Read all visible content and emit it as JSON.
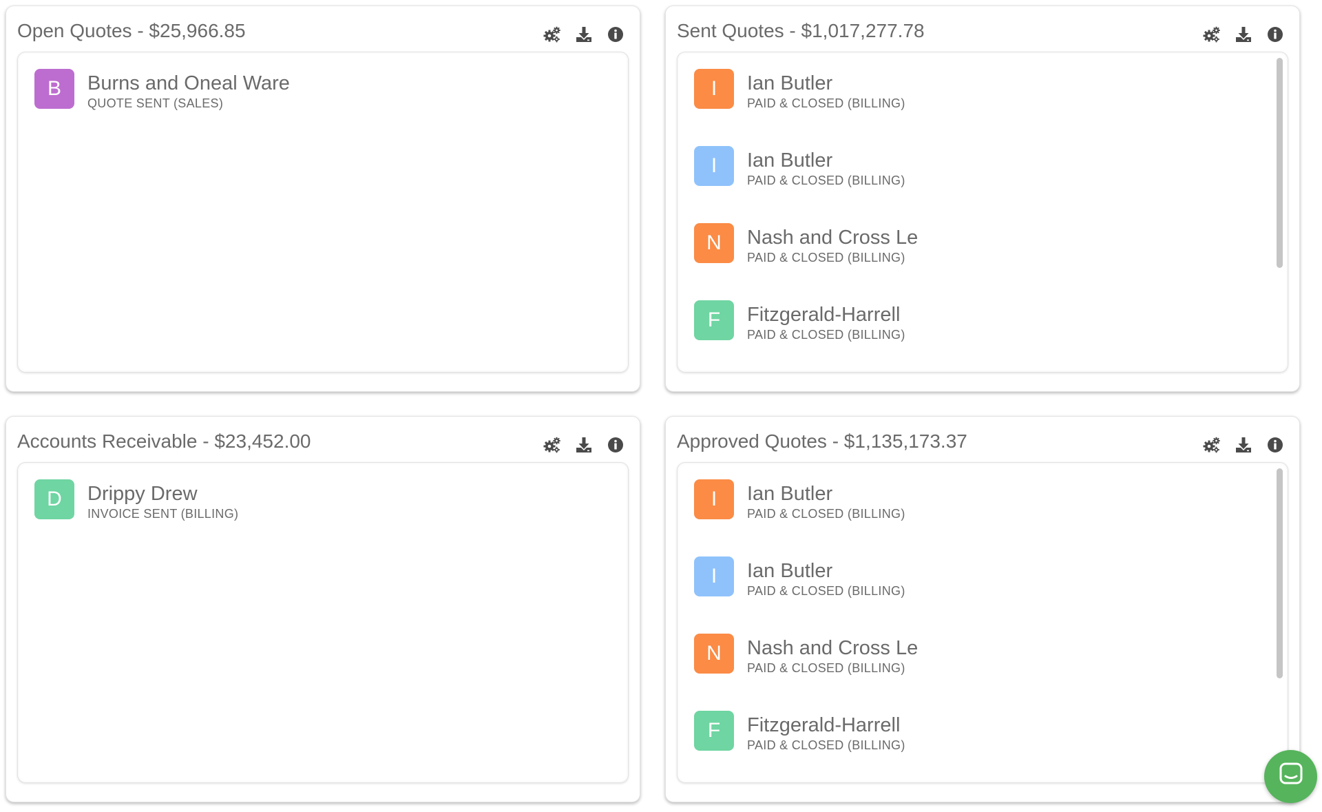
{
  "colors": {
    "orange": "#fb8b45",
    "blue": "#8fc2fb",
    "green": "#6fd5a2",
    "purple": "#bd6dd0",
    "chat": "#56b45c"
  },
  "icons": {
    "settings": "gears-icon",
    "download": "download-icon",
    "info": "info-icon",
    "chat": "chat-icon"
  },
  "panels": [
    {
      "title": "Open Quotes - $25,966.85",
      "items": [
        {
          "initial": "B",
          "name": "Burns and Oneal Ware",
          "status": "QUOTE SENT (SALES)",
          "color": "#bd6dd0"
        }
      ]
    },
    {
      "title": "Sent Quotes - $1,017,277.78",
      "items": [
        {
          "initial": "I",
          "name": "Ian Butler",
          "status": "PAID & CLOSED (BILLING)",
          "color": "#fb8b45"
        },
        {
          "initial": "I",
          "name": "Ian Butler",
          "status": "PAID & CLOSED (BILLING)",
          "color": "#8fc2fb"
        },
        {
          "initial": "N",
          "name": "Nash and Cross Le",
          "status": "PAID & CLOSED (BILLING)",
          "color": "#fb8b45"
        },
        {
          "initial": "F",
          "name": "Fitzgerald-Harrell",
          "status": "PAID & CLOSED (BILLING)",
          "color": "#6fd5a2"
        }
      ]
    },
    {
      "title": "Accounts Receivable - $23,452.00",
      "items": [
        {
          "initial": "D",
          "name": "Drippy Drew",
          "status": "INVOICE SENT (BILLING)",
          "color": "#6fd5a2"
        }
      ]
    },
    {
      "title": "Approved Quotes - $1,135,173.37",
      "items": [
        {
          "initial": "I",
          "name": "Ian Butler",
          "status": "PAID & CLOSED (BILLING)",
          "color": "#fb8b45"
        },
        {
          "initial": "I",
          "name": "Ian Butler",
          "status": "PAID & CLOSED (BILLING)",
          "color": "#8fc2fb"
        },
        {
          "initial": "N",
          "name": "Nash and Cross Le",
          "status": "PAID & CLOSED (BILLING)",
          "color": "#fb8b45"
        },
        {
          "initial": "F",
          "name": "Fitzgerald-Harrell",
          "status": "PAID & CLOSED (BILLING)",
          "color": "#6fd5a2"
        }
      ]
    }
  ]
}
